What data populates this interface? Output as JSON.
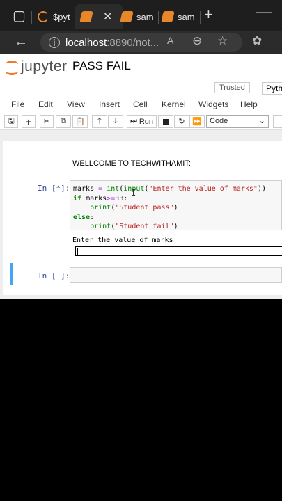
{
  "browser": {
    "tabs": [
      {
        "title": "$pyt",
        "icon": "jupyter-icon"
      },
      {
        "title": "",
        "icon": "notebook-icon",
        "active": true
      },
      {
        "title": "sam",
        "icon": "notebook-icon"
      },
      {
        "title": "sam",
        "icon": "notebook-icon"
      }
    ],
    "url_host": "localhost",
    "url_rest": ":8890/not..."
  },
  "jupyter": {
    "logo_text": "jupyter",
    "notebook_title": "PASS FAIL",
    "trusted_label": "Trusted",
    "kernel_label": "Pytho",
    "menu": [
      "File",
      "Edit",
      "View",
      "Insert",
      "Cell",
      "Kernel",
      "Widgets",
      "Help"
    ],
    "run_label": "Run",
    "cell_type": "Code"
  },
  "notebook": {
    "markdown_text": "WELLCOME TO TECHWITHAMIT:",
    "cell1_prompt": "In [*]:",
    "code_lines": [
      "marks = int(input(\"Enter the value of marks\"))",
      "if marks>=33:",
      "    print(\"Student pass\")",
      "else:",
      "    print(\"Student fail\")"
    ],
    "output_text": "Enter the value of marks",
    "cell2_prompt": "In [ ]:"
  },
  "colors": {
    "jupyter_orange": "#f37726",
    "selected_cell_border": "#42a5f5",
    "prompt_blue": "#303f9f"
  }
}
